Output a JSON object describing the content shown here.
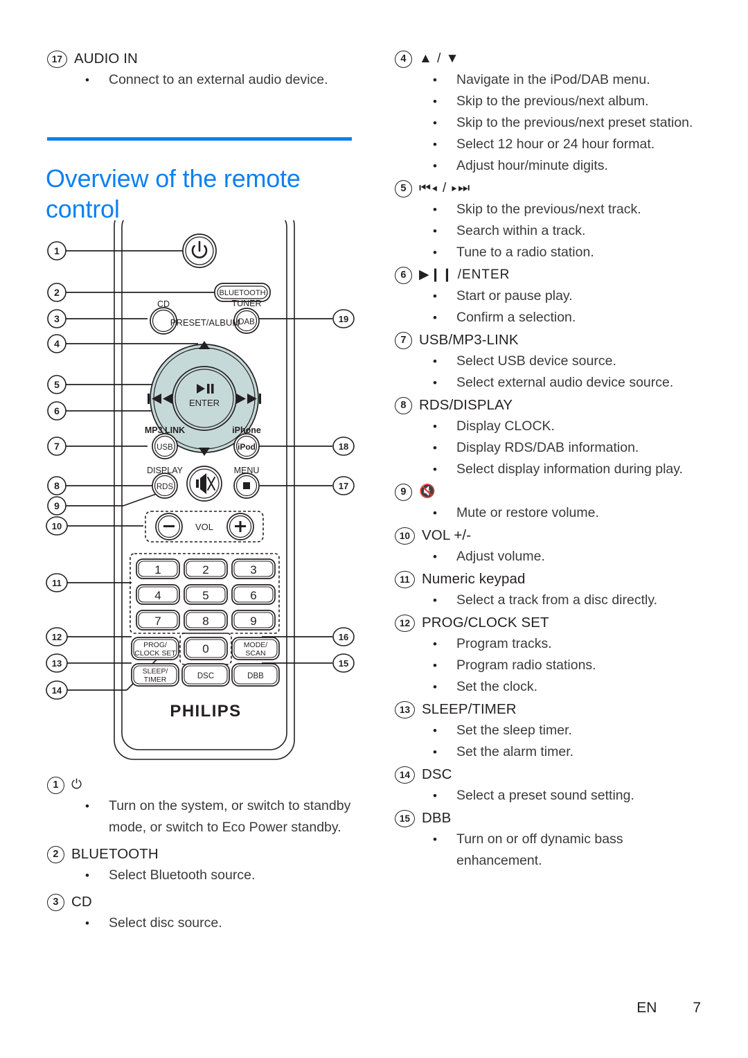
{
  "heading": {
    "title": "Overview of the remote control",
    "accent_color": "#0d80f2"
  },
  "footer": {
    "language": "EN",
    "page_number": "7"
  },
  "left_column": {
    "top_entry": {
      "number": "17",
      "label": "AUDIO IN",
      "bullets": [
        "Connect to an external audio device."
      ]
    },
    "entries": [
      {
        "number": "1",
        "label": "⏻",
        "is_glyph": true,
        "bullets": [
          "Turn on the system, or switch to standby mode, or switch to Eco Power standby."
        ]
      },
      {
        "number": "2",
        "label": "BLUETOOTH",
        "bullets": [
          "Select Bluetooth source."
        ]
      },
      {
        "number": "3",
        "label": "CD",
        "bullets": [
          "Select disc source."
        ]
      }
    ]
  },
  "right_column": {
    "entries": [
      {
        "number": "4",
        "label": "▲ / ▼",
        "is_glyph": true,
        "bullets": [
          "Navigate in the iPod/DAB menu.",
          "Skip to the previous/next album.",
          "Skip to the previous/next preset station.",
          "Select 12 hour or 24 hour format.",
          "Adjust hour/minute digits."
        ]
      },
      {
        "number": "5",
        "label": "⏮◂ / ▸⏭",
        "is_glyph": true,
        "bullets": [
          "Skip to the previous/next track.",
          "Search within a track.",
          "Tune to a radio station."
        ]
      },
      {
        "number": "6",
        "label": "▶❙❙ /ENTER",
        "is_glyph": true,
        "bullets": [
          "Start or pause play.",
          "Confirm a selection."
        ]
      },
      {
        "number": "7",
        "label": "USB/MP3-LINK",
        "bullets": [
          "Select USB device source.",
          "Select external audio device source."
        ]
      },
      {
        "number": "8",
        "label": "RDS/DISPLAY",
        "bullets": [
          "Display CLOCK.",
          "Display RDS/DAB information.",
          "Select display information during play."
        ]
      },
      {
        "number": "9",
        "label": "🔇",
        "is_glyph": true,
        "bullets": [
          "Mute or restore volume."
        ]
      },
      {
        "number": "10",
        "label": "VOL +/-",
        "bullets": [
          "Adjust volume."
        ]
      },
      {
        "number": "11",
        "label": "Numeric keypad",
        "bullets": [
          "Select a track from a disc directly."
        ]
      },
      {
        "number": "12",
        "label": "PROG/CLOCK SET",
        "bullets": [
          "Program tracks.",
          "Program radio stations.",
          "Set the clock."
        ]
      },
      {
        "number": "13",
        "label": "SLEEP/TIMER",
        "bullets": [
          "Set the sleep timer.",
          "Set the alarm timer."
        ]
      },
      {
        "number": "14",
        "label": "DSC",
        "bullets": [
          "Select a preset sound setting."
        ]
      },
      {
        "number": "15",
        "label": "DBB",
        "bullets": [
          "Turn on or off dynamic bass enhancement."
        ]
      }
    ]
  },
  "remote_figure": {
    "brand": "PHILIPS",
    "navpad_color": "#c6d9d9",
    "callouts_left": [
      "1",
      "2",
      "3",
      "4",
      "5",
      "6",
      "7",
      "8",
      "9",
      "10",
      "11",
      "12",
      "13",
      "14"
    ],
    "callouts_right": [
      "19",
      "18",
      "17",
      "16",
      "15"
    ],
    "buttons": {
      "power": "⏻",
      "bluetooth": "BLUETOOTH",
      "cd_label": "CD",
      "tuner_label": "TUNER",
      "dab": "DAB",
      "preset_album": "PRESET/ALBUM",
      "play_pause": "▶❙❙",
      "enter": "ENTER",
      "prev": "⏮◂",
      "next": "▸⏭",
      "mp3_link_label": "MP3 LINK",
      "usb": "USB",
      "iphone_label": "iPhone",
      "ipod": "iPod",
      "display_label": "DISPLAY",
      "rds": "RDS",
      "menu_label": "MENU",
      "stop": "■",
      "mute": "mute-icon",
      "vol_minus": "−",
      "vol_label": "VOL",
      "vol_plus": "+",
      "keypad": [
        "1",
        "2",
        "3",
        "4",
        "5",
        "6",
        "7",
        "8",
        "9",
        "0"
      ],
      "prog_clock_set": [
        "PROG/",
        "CLOCK SET"
      ],
      "mode_scan": [
        "MODE/",
        "SCAN"
      ],
      "sleep_timer": [
        "SLEEP/",
        "TIMER"
      ],
      "dsc": "DSC",
      "dbb": "DBB"
    }
  }
}
